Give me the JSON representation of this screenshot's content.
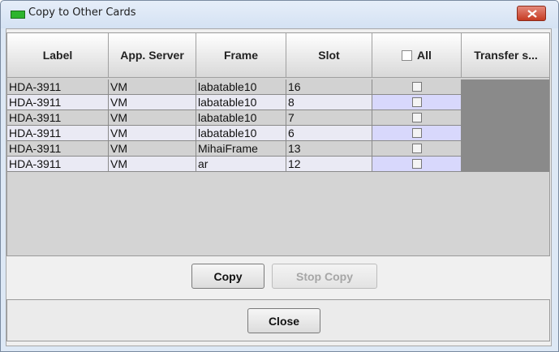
{
  "window": {
    "title": "Copy to Other Cards"
  },
  "table": {
    "columns": [
      "Label",
      "App. Server",
      "Frame",
      "Slot",
      "All",
      "Transfer s..."
    ],
    "rows": [
      {
        "label": "HDA-3911",
        "app_server": "VM",
        "frame": "labatable10",
        "slot": "16"
      },
      {
        "label": "HDA-3911",
        "app_server": "VM",
        "frame": "labatable10",
        "slot": "8"
      },
      {
        "label": "HDA-3911",
        "app_server": "VM",
        "frame": "labatable10",
        "slot": "7"
      },
      {
        "label": "HDA-3911",
        "app_server": "VM",
        "frame": "labatable10",
        "slot": "6"
      },
      {
        "label": "HDA-3911",
        "app_server": "VM",
        "frame": "MihaiFrame",
        "slot": "13"
      },
      {
        "label": "HDA-3911",
        "app_server": "VM",
        "frame": "ar",
        "slot": "12"
      }
    ]
  },
  "buttons": {
    "copy": "Copy",
    "stop_copy": "Stop Copy",
    "close": "Close"
  },
  "colors": {
    "title_led": "#2db52d",
    "close_button": "#c63b22",
    "transfer_cell": "#8a8a8a",
    "selected_check_cell": "#d8d8fc"
  }
}
